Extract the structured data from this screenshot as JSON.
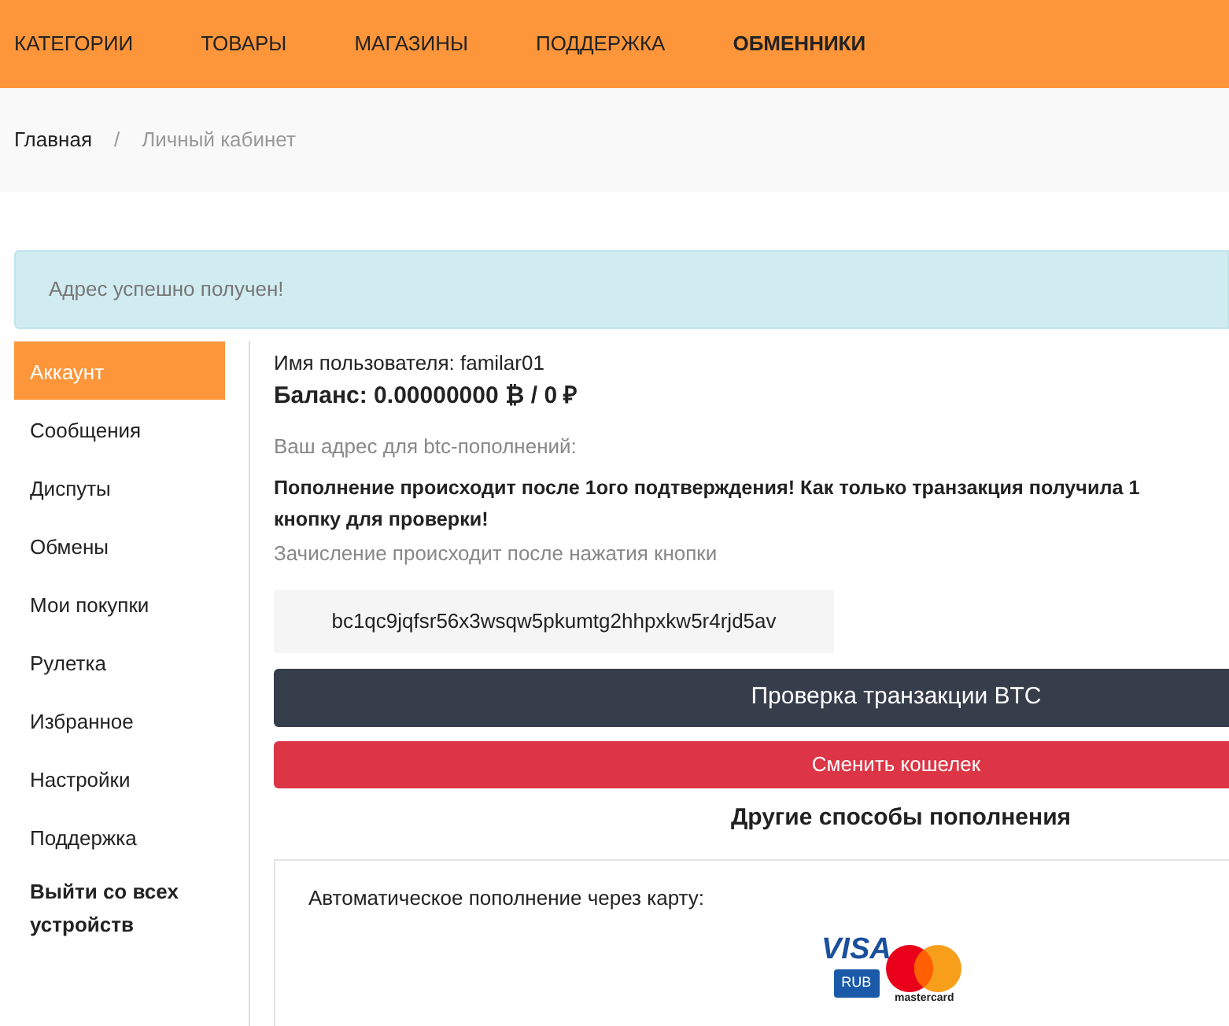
{
  "nav": [
    {
      "label": "КАТЕГОРИИ",
      "selected": false
    },
    {
      "label": "ТОВАРЫ",
      "selected": false
    },
    {
      "label": "МАГАЗИНЫ",
      "selected": false
    },
    {
      "label": "ПОДДЕРЖКА",
      "selected": false
    },
    {
      "label": "ОБМЕННИКИ",
      "selected": true
    }
  ],
  "breadcrumb": [
    "Главная",
    "Личный кабинет"
  ],
  "breadcrumb_separator": "/",
  "alert": "Адрес успешно получен!",
  "sidebar": [
    {
      "label": "Аккаунт",
      "selected": true
    },
    {
      "label": "Сообщения",
      "selected": false
    },
    {
      "label": "Диспуты",
      "selected": false
    },
    {
      "label": "Обмены",
      "selected": false
    },
    {
      "label": "Мои покупки",
      "selected": false
    },
    {
      "label": "Рулетка",
      "selected": false
    },
    {
      "label": "Избранное",
      "selected": false
    },
    {
      "label": "Настройки",
      "selected": false
    },
    {
      "label": "Поддержка",
      "selected": false
    },
    {
      "label": "Выйти со всех устройств",
      "selected": false,
      "kind": "logout"
    }
  ],
  "account": {
    "username": "Имя пользователя: familar01",
    "balance": "Баланс: 0.00000000 ₿ / 0 ₽",
    "address_label": "Ваш адрес для btc-пополнений:",
    "notice_lines": [
      "Пополнение происходит после 1ого подтверждения! Как только транзакция получила 1",
      "кнопку для проверки!"
    ],
    "credit_note": "Зачисление происходит после нажатия кнопки",
    "address": "bc1qc9jqfsr56x3wsqw5pkumtg2hhpxkw5r4rjd5av",
    "check_button": "Проверка транзакции BTC",
    "change_button": "Сменить кошелек",
    "other_title": "Другие способы пополнения",
    "card": {
      "text": "Автоматическое пополнение через карту:",
      "visa": "VISA",
      "rub": "RUB",
      "mastercard": "mastercard"
    }
  }
}
